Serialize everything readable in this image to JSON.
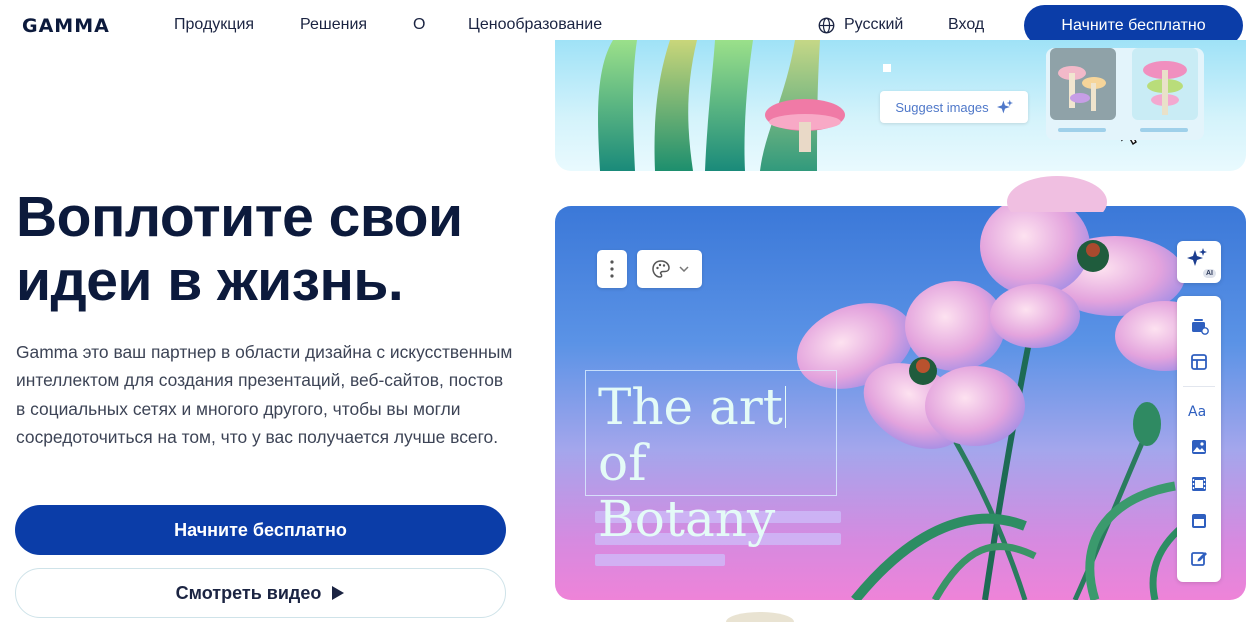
{
  "header": {
    "logo": "GAMMA",
    "nav": [
      "Продукция",
      "Решения",
      "О",
      "Ценообразование"
    ],
    "language": "Русский",
    "login": "Вход",
    "cta": "Начните бесплатно"
  },
  "hero": {
    "title_line1": "Воплотите свои",
    "title_line2": "идеи в жизнь.",
    "description": "Gamma это ваш партнер в области дизайна с искусственным интеллектом для создания презентаций, веб-сайтов, постов в социальных сетях и многого другого, чтобы вы могли сосредоточиться на том, что у вас получается лучше всего.",
    "primary_button": "Начните бесплатно",
    "secondary_button": "Смотреть видео"
  },
  "showcase": {
    "suggest_label": "Suggest images",
    "card_title_line1": "The art",
    "card_title_line2": "of Botany",
    "ai_badge": "AI",
    "toolbar_icons": [
      "cards-add-icon",
      "layout-icon",
      "text-icon",
      "image-icon",
      "video-icon",
      "embed-icon",
      "edit-icon"
    ]
  },
  "colors": {
    "brand": "#0b3da8",
    "heading": "#0c1a3c"
  }
}
